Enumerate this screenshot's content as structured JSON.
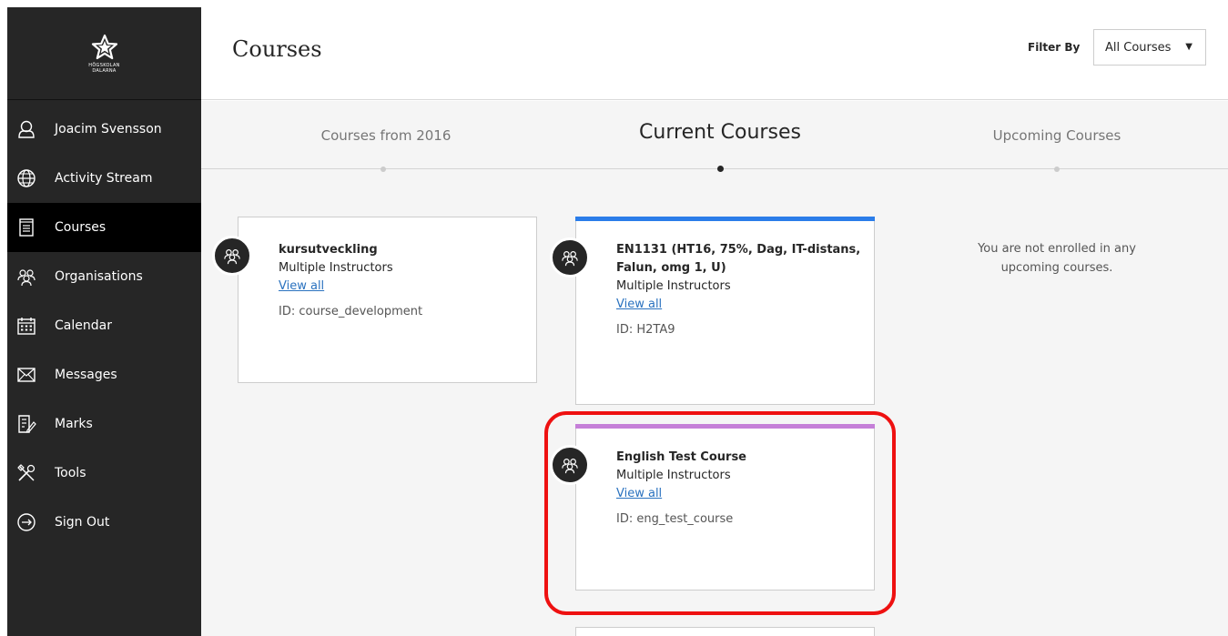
{
  "logo": {
    "line1": "HÖGSKOLAN",
    "line2": "DALARNA"
  },
  "sidebar": {
    "items": [
      {
        "label": "Joacim Svensson",
        "icon": "user-icon"
      },
      {
        "label": "Activity Stream",
        "icon": "globe-icon"
      },
      {
        "label": "Courses",
        "icon": "courses-icon"
      },
      {
        "label": "Organisations",
        "icon": "organisations-icon"
      },
      {
        "label": "Calendar",
        "icon": "calendar-icon"
      },
      {
        "label": "Messages",
        "icon": "envelope-icon"
      },
      {
        "label": "Marks",
        "icon": "marks-icon"
      },
      {
        "label": "Tools",
        "icon": "tools-icon"
      },
      {
        "label": "Sign Out",
        "icon": "sign-out-icon"
      }
    ]
  },
  "header": {
    "title": "Courses",
    "filter_label": "Filter By",
    "filter_value": "All Courses"
  },
  "tabs": [
    {
      "label": "Courses from 2016"
    },
    {
      "label": "Current Courses"
    },
    {
      "label": "Upcoming Courses"
    }
  ],
  "cards": [
    {
      "title": "kursutveckling",
      "instructors": "Multiple Instructors",
      "link": "View all",
      "id": "ID: course_development",
      "stripe": ""
    },
    {
      "title": "EN1131 (HT16, 75%, Dag, IT-distans, Falun, omg 1, U)",
      "instructors": "Multiple Instructors",
      "link": "View all",
      "id": "ID: H2TA9",
      "stripe": "#2b7de9"
    },
    {
      "title": "English Test Course",
      "instructors": "Multiple Instructors",
      "link": "View all",
      "id": "ID: eng_test_course",
      "stripe": "#c57fd8"
    }
  ],
  "upcoming_empty": "You are not enrolled in any upcoming courses.",
  "colors": {
    "accent_blue": "#2b7de9",
    "accent_purple": "#c57fd8",
    "highlight": "#ee1111"
  }
}
